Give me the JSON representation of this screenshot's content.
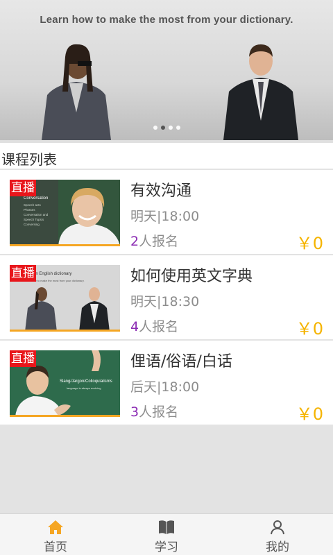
{
  "banner": {
    "caption": "Learn how to make the most from your dictionary.",
    "dots": 4,
    "active_dot": 1
  },
  "section": {
    "title": "课程列表"
  },
  "courses": [
    {
      "live_tag": "直播",
      "title": "有效沟通",
      "time": "明天|18:00",
      "enroll_count": "2",
      "enroll_suffix": "人报名",
      "price": "￥0",
      "thumb_text": [
        "Conversation",
        "Speech acts",
        "Phrases",
        "Conversation and",
        "Speech Topics",
        "Conversing"
      ]
    },
    {
      "live_tag": "直播",
      "title": "如何使用英文字典",
      "time": "明天|18:30",
      "enroll_count": "4",
      "enroll_suffix": "人报名",
      "price": "￥0",
      "thumb_text": [
        "an English dictionary",
        "Learn how to make the most from your dictionary."
      ]
    },
    {
      "live_tag": "直播",
      "title": "俚语/俗语/白话",
      "time": "后天|18:00",
      "enroll_count": "3",
      "enroll_suffix": "人报名",
      "price": "￥0",
      "thumb_text": [
        "Slang/Jargon/Colloquialisms",
        "language is always evolving"
      ]
    }
  ],
  "tabbar": {
    "items": [
      {
        "label": "首页",
        "icon": "home-icon",
        "active": true
      },
      {
        "label": "学习",
        "icon": "book-icon",
        "active": false
      },
      {
        "label": "我的",
        "icon": "user-icon",
        "active": false
      }
    ]
  },
  "colors": {
    "live_tag": "#e8161b",
    "price": "#f5b400",
    "enroll_count": "#8b2bb3",
    "accent_active_tab": "#f5a623",
    "thumb_bar": "#f5a623"
  }
}
